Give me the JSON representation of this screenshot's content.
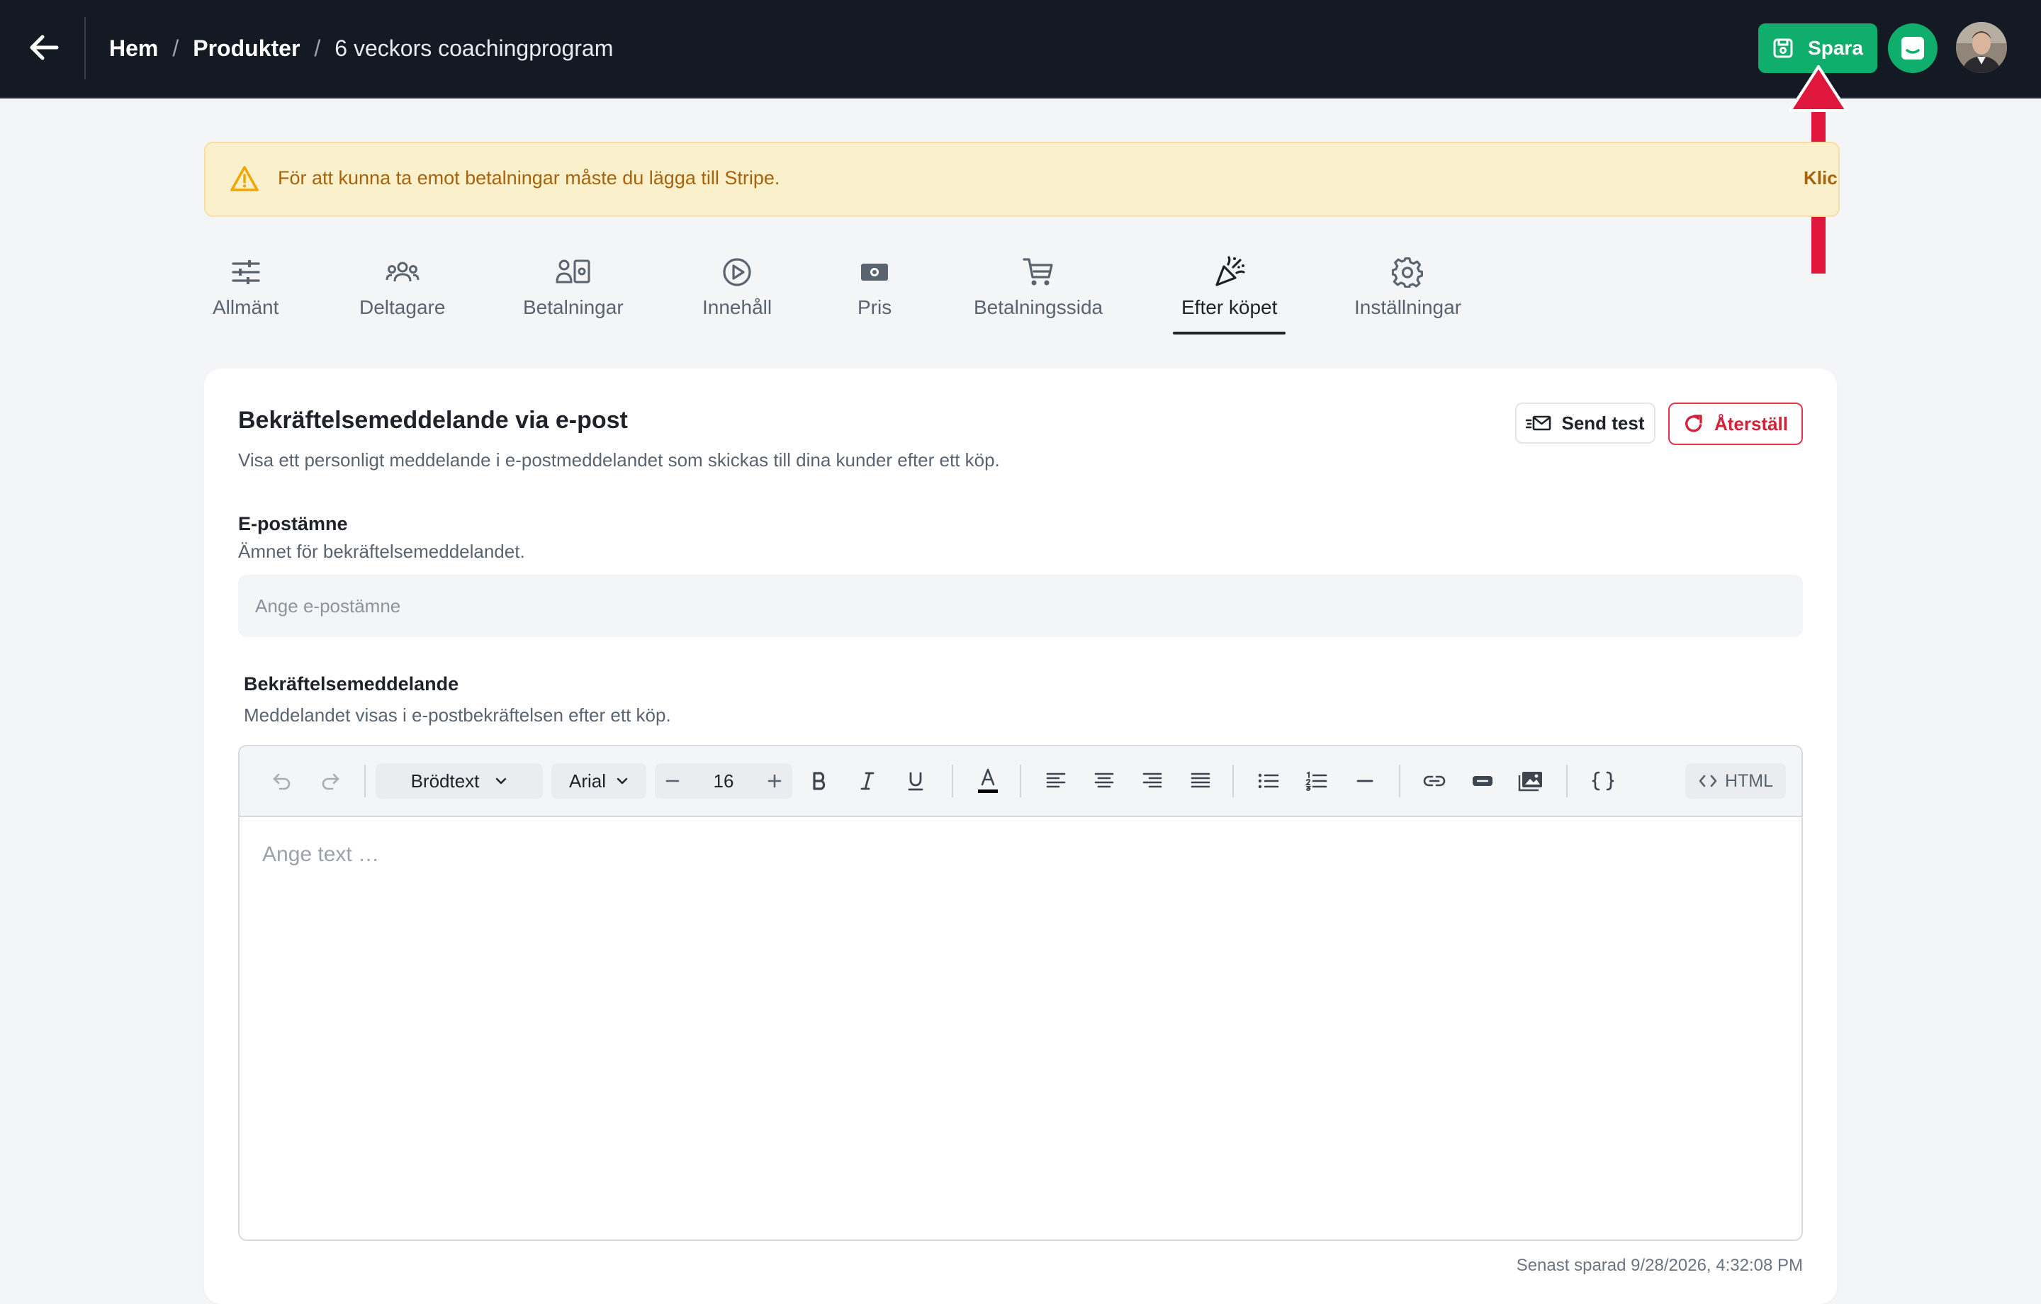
{
  "header": {
    "breadcrumb": {
      "home": "Hem",
      "sep1": "/",
      "products": "Produkter",
      "sep2": "/",
      "current": "6 veckors coachingprogram"
    },
    "save_label": "Spara",
    "icons": [
      "arrow-left-icon",
      "save-icon",
      "chat-icon",
      "avatar"
    ]
  },
  "banner": {
    "message": "För att kunna ta emot betalningar måste du lägga till Stripe.",
    "action": "Klicka här för att göra de"
  },
  "tabs": [
    {
      "label": "Allmänt",
      "icon": "sliders-icon"
    },
    {
      "label": "Deltagare",
      "icon": "users-icon"
    },
    {
      "label": "Betalningar",
      "icon": "payments-icon"
    },
    {
      "label": "Innehåll",
      "icon": "play-circle-icon"
    },
    {
      "label": "Pris",
      "icon": "cash-icon"
    },
    {
      "label": "Betalningssida",
      "icon": "cart-icon"
    },
    {
      "label": "Efter köpet",
      "icon": "party-icon",
      "active": true
    },
    {
      "label": "Inställningar",
      "icon": "gear-icon"
    }
  ],
  "card": {
    "title": "Bekräftelsemeddelande via e-post",
    "description": "Visa ett personligt meddelande i e-postmeddelandet som skickas till dina kunder efter ett köp.",
    "send_test": "Send test",
    "reset": "Återställ",
    "subject": {
      "label": "E-postämne",
      "help": "Ämnet för bekräftelsemeddelandet.",
      "placeholder": "Ange e-postämne",
      "value": ""
    },
    "message": {
      "label": "Bekräftelsemeddelande",
      "help": "Meddelandet visas i e-postbekräftelsen efter ett köp.",
      "placeholder": "Ange text …"
    },
    "last_saved": "Senast sparad 9/28/2026, 4:32:08 PM"
  },
  "toolbar": {
    "block_style": "Brödtext",
    "font": "Arial",
    "font_size": "16",
    "html_label": "HTML",
    "text_color": "#000000"
  },
  "colors": {
    "topbar": "#141a24",
    "accent_green": "#0fae6c",
    "danger": "#e0354a",
    "warning_bg": "#fbf0cc",
    "warning_text": "#a8630a",
    "annotation": "#e0173d"
  }
}
